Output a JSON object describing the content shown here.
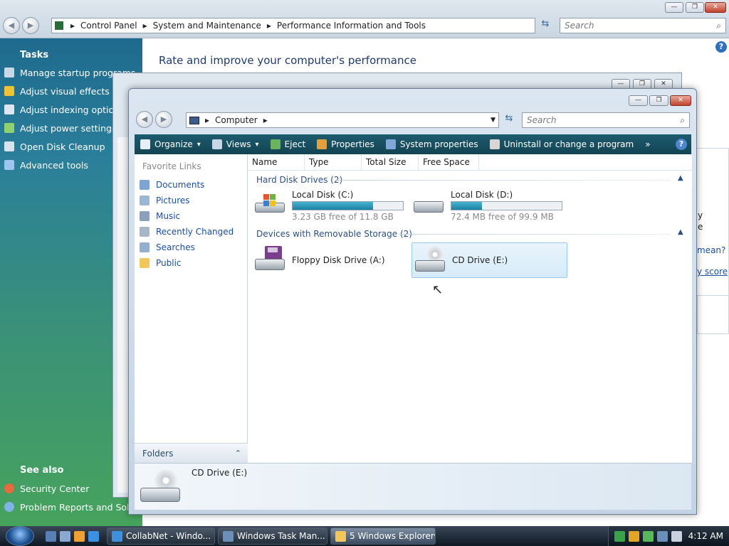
{
  "control_panel": {
    "breadcrumb": [
      "Control Panel",
      "System and Maintenance",
      "Performance Information and Tools"
    ],
    "search_placeholder": "Search",
    "title": "Rate and improve your computer's performance",
    "tasks_heading": "Tasks",
    "tasks": [
      {
        "label": "Manage startup programs",
        "icon": "startup-icon",
        "color": "#c9d7e6"
      },
      {
        "label": "Adjust visual effects",
        "icon": "shield-icon",
        "color": "#f1c232"
      },
      {
        "label": "Adjust indexing options",
        "icon": "indexing-icon",
        "color": "#dfe6ef"
      },
      {
        "label": "Adjust power settings",
        "icon": "power-icon",
        "color": "#8fd16c"
      },
      {
        "label": "Open Disk Cleanup",
        "icon": "disk-cleanup-icon",
        "color": "#d9e3ec"
      },
      {
        "label": "Advanced tools",
        "icon": "tools-icon",
        "color": "#9ec5f0"
      }
    ],
    "see_also_heading": "See also",
    "see_also": [
      {
        "label": "Security Center",
        "icon": "security-icon",
        "color": "#e86a3c"
      },
      {
        "label": "Problem Reports and Solutions",
        "icon": "reports-icon",
        "color": "#7fb3e8"
      }
    ],
    "right_fragments": [
      "y",
      "e",
      "mean?",
      "y score"
    ]
  },
  "explorer": {
    "address": "Computer",
    "search_placeholder": "Search",
    "toolbar": [
      {
        "label": "Organize",
        "icon": "organize-icon",
        "dropdown": true
      },
      {
        "label": "Views",
        "icon": "views-icon",
        "dropdown": true
      },
      {
        "label": "Eject",
        "icon": "eject-icon",
        "dropdown": false
      },
      {
        "label": "Properties",
        "icon": "properties-icon",
        "dropdown": false
      },
      {
        "label": "System properties",
        "icon": "system-properties-icon",
        "dropdown": false
      },
      {
        "label": "Uninstall or change a program",
        "icon": "uninstall-icon",
        "dropdown": false
      }
    ],
    "toolbar_more": "»",
    "favorite_links_heading": "Favorite Links",
    "favorite_links": [
      {
        "label": "Documents",
        "icon": "documents-icon"
      },
      {
        "label": "Pictures",
        "icon": "pictures-icon"
      },
      {
        "label": "Music",
        "icon": "music-icon"
      },
      {
        "label": "Recently Changed",
        "icon": "recently-changed-icon"
      },
      {
        "label": "Searches",
        "icon": "searches-icon"
      },
      {
        "label": "Public",
        "icon": "public-folder-icon"
      }
    ],
    "folders_label": "Folders",
    "columns": [
      "Name",
      "Type",
      "Total Size",
      "Free Space"
    ],
    "groups": {
      "hard_disks": "Hard Disk Drives (2)",
      "removable": "Devices with Removable Storage (2)"
    },
    "hard_drives": [
      {
        "name": "Local Disk (C:)",
        "free_text": "3.23 GB free of 11.8 GB",
        "used_fraction": 0.73
      },
      {
        "name": "Local Disk (D:)",
        "free_text": "72.4 MB free of 99.9 MB",
        "used_fraction": 0.28
      }
    ],
    "removable_drives": [
      {
        "name": "Floppy Disk Drive (A:)",
        "selected": false
      },
      {
        "name": "CD Drive (E:)",
        "selected": true
      }
    ],
    "details_name": "CD Drive (E:)"
  },
  "taskbar": {
    "buttons": [
      {
        "label": "CollabNet - Windo...",
        "icon": "ie-icon",
        "active": false
      },
      {
        "label": "Windows Task Man...",
        "icon": "task-manager-icon",
        "active": false
      },
      {
        "label": "5 Windows Explorer",
        "icon": "explorer-folder-icon",
        "active": true
      }
    ],
    "clock": "4:12 AM"
  }
}
